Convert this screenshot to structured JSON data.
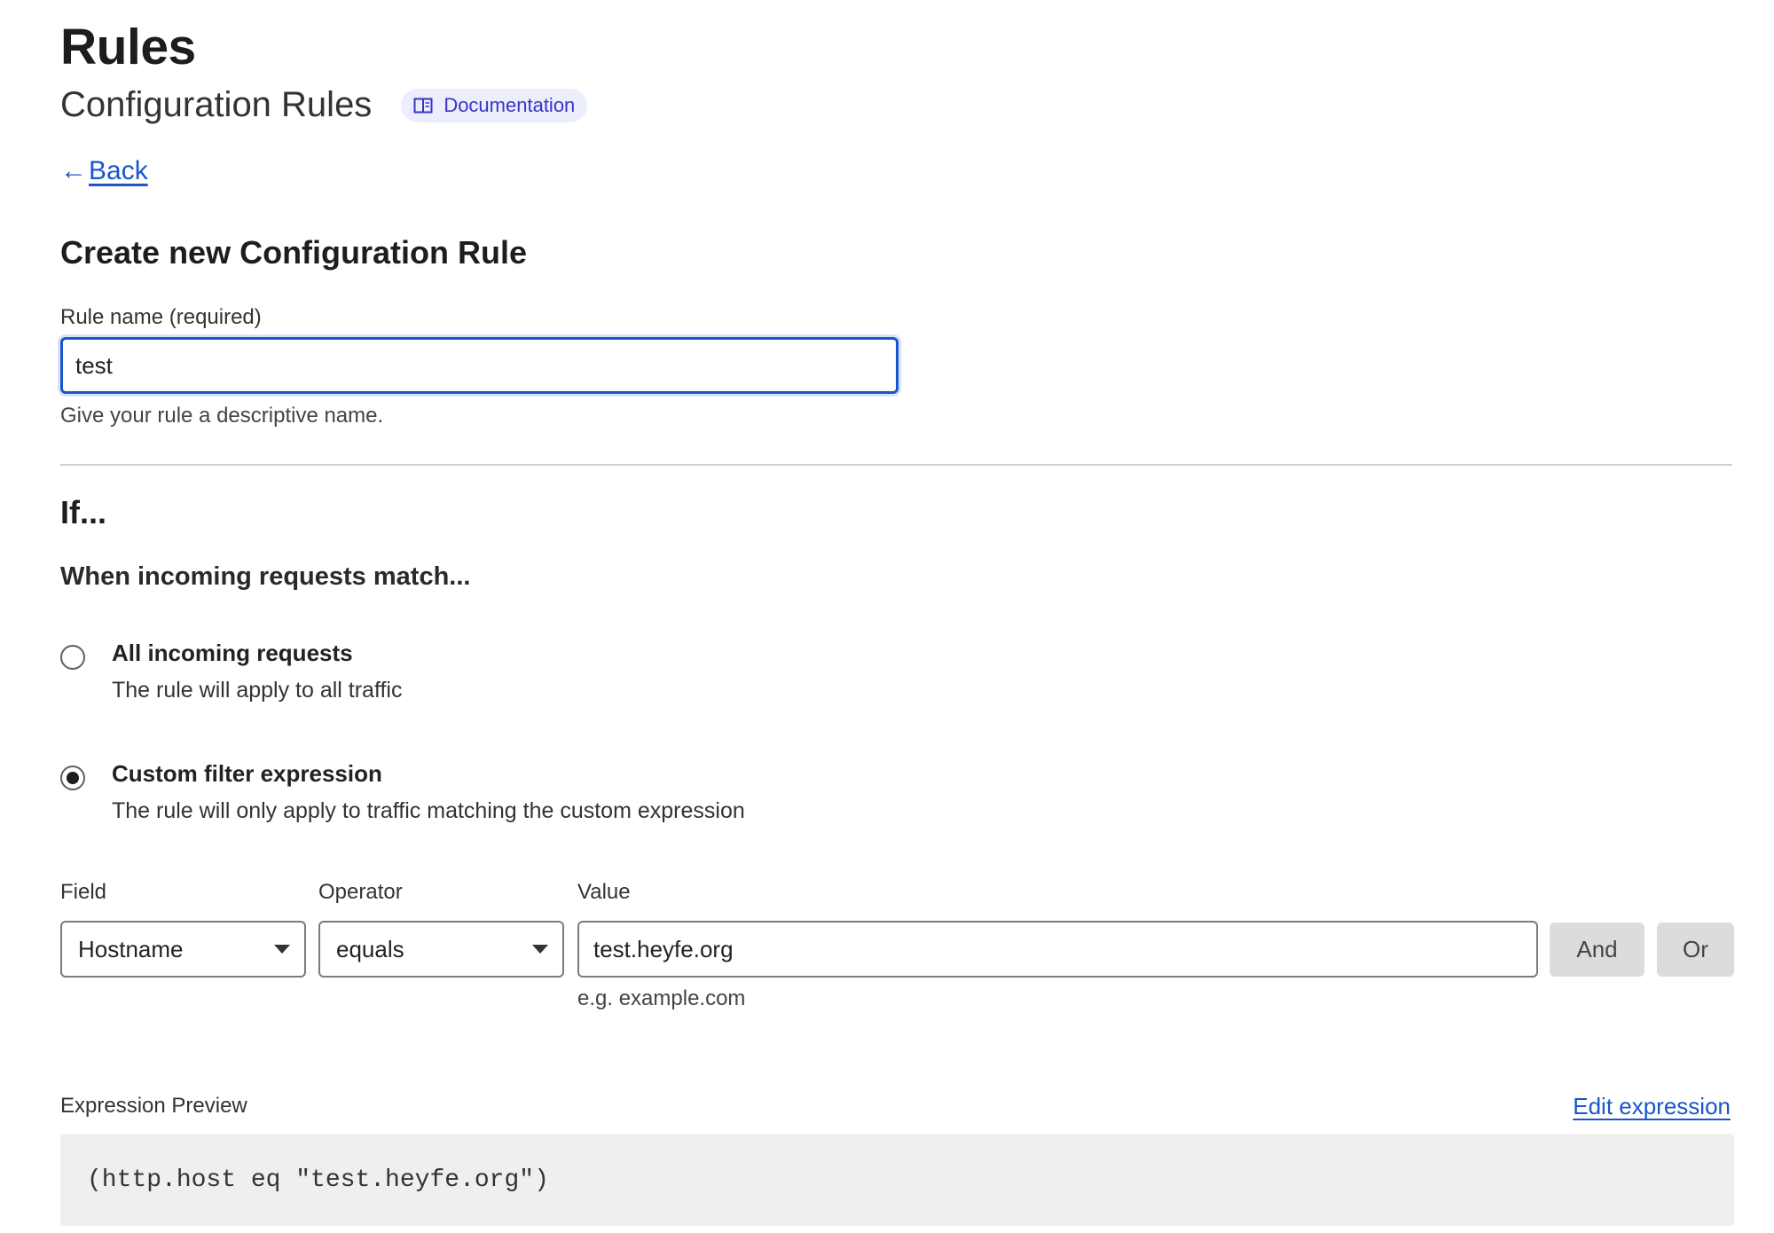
{
  "header": {
    "title": "Rules",
    "subtitle": "Configuration Rules",
    "doc_link": "Documentation"
  },
  "nav": {
    "back_label": "Back",
    "back_arrow": "←"
  },
  "form": {
    "section_title": "Create new Configuration Rule",
    "rule_name": {
      "label": "Rule name (required)",
      "value": "test",
      "help": "Give your rule a descriptive name."
    }
  },
  "condition": {
    "title": "If...",
    "subtitle": "When incoming requests match...",
    "options": [
      {
        "title": "All incoming requests",
        "desc": "The rule will apply to all traffic",
        "checked": false
      },
      {
        "title": "Custom filter expression",
        "desc": "The rule will only apply to traffic matching the custom expression",
        "checked": true
      }
    ],
    "builder": {
      "field_label": "Field",
      "operator_label": "Operator",
      "value_label": "Value",
      "field_value": "Hostname",
      "operator_value": "equals",
      "value_value": "test.heyfe.org",
      "value_help": "e.g. example.com",
      "and_label": "And",
      "or_label": "Or"
    },
    "preview": {
      "label": "Expression Preview",
      "edit_label": "Edit expression",
      "expression": "(http.host eq \"test.heyfe.org\")"
    }
  },
  "colors": {
    "link": "#1a56c9",
    "doc_pill_bg": "#eceefe",
    "doc_pill_text": "#3a34c4"
  },
  "icons": {
    "doc": "book-icon",
    "back": "arrow-left-icon",
    "select": "caret-down-icon"
  }
}
